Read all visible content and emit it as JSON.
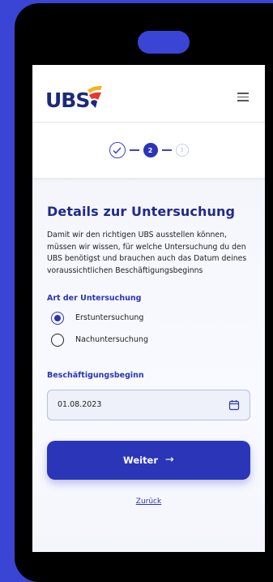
{
  "header": {
    "logo_text": "UBS",
    "menu_icon": "hamburger-menu-icon"
  },
  "stepper": {
    "step1_icon": "checkmark-icon",
    "step2_label": "2",
    "step3_label": "3"
  },
  "main": {
    "title": "Details zur Untersuchung",
    "description": "Damit wir den richtigen UBS ausstellen können, müssen wir wissen, für welche Untersuchung du den UBS benötigst und brauchen auch das Datum deines voraussichtlichen Beschäftigungsbeginns",
    "exam_type": {
      "label": "Art der Untersuchung",
      "options": [
        {
          "label": "Erstuntersuchung",
          "checked": true
        },
        {
          "label": "Nachuntersuchung",
          "checked": false
        }
      ]
    },
    "start_date": {
      "label": "Beschäftigungsbeginn",
      "value": "01.08.2023",
      "icon": "calendar-icon"
    },
    "next_button": {
      "label": "Weiter",
      "arrow": "→"
    },
    "back_link": "Zurück"
  },
  "colors": {
    "background": "#3a45d6",
    "primary": "#2a35b8",
    "title": "#202a8a"
  }
}
